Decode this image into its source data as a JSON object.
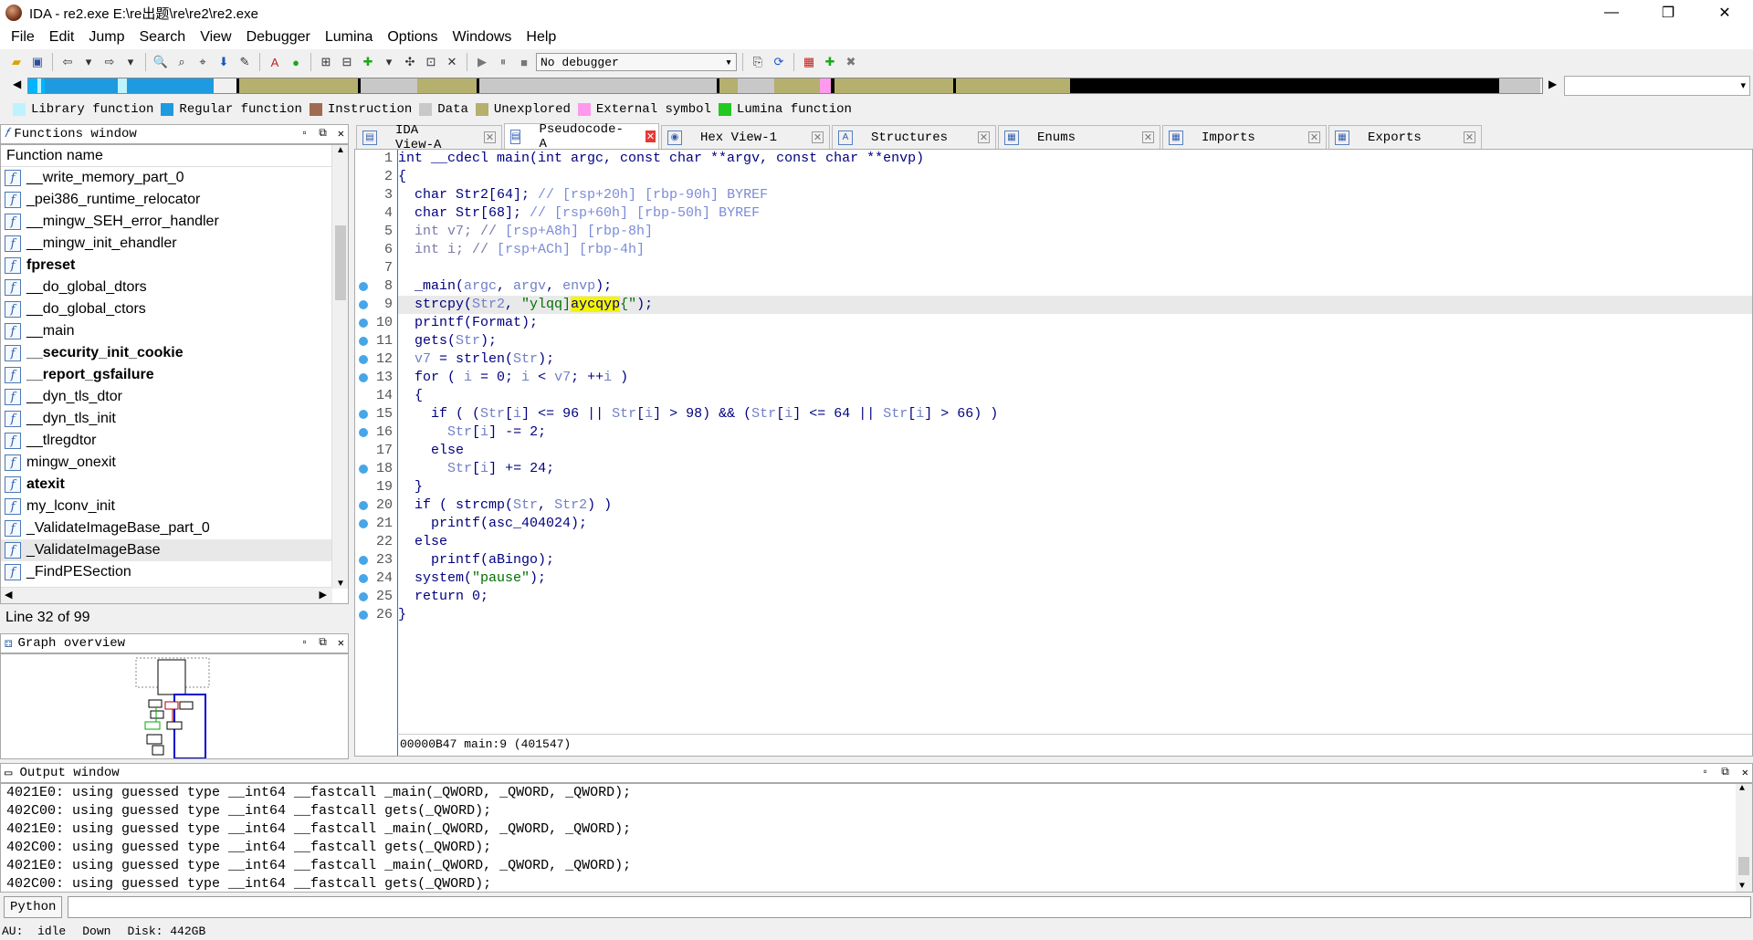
{
  "titlebar": {
    "title": "IDA - re2.exe E:\\re出题\\re\\re2\\re2.exe",
    "min": "—",
    "max": "❐",
    "close": "✕"
  },
  "menu": [
    "File",
    "Edit",
    "Jump",
    "Search",
    "View",
    "Debugger",
    "Lumina",
    "Options",
    "Windows",
    "Help"
  ],
  "toolbar": {
    "debugger_select": "No debugger"
  },
  "legend": [
    {
      "label": "Library function",
      "color": "#bdf3ff"
    },
    {
      "label": "Regular function",
      "color": "#1e9ae0"
    },
    {
      "label": "Instruction",
      "color": "#a06a50"
    },
    {
      "label": "Data",
      "color": "#c8c8c8"
    },
    {
      "label": "Unexplored",
      "color": "#b5b06d"
    },
    {
      "label": "External symbol",
      "color": "#ff99ee"
    },
    {
      "label": "Lumina function",
      "color": "#22c922"
    }
  ],
  "navstrip": [
    {
      "w": 10,
      "c": "#00b4ff"
    },
    {
      "w": 4,
      "c": "#bdf3ff"
    },
    {
      "w": 4,
      "c": "#00b4ff"
    },
    {
      "w": 80,
      "c": "#1e9ae0"
    },
    {
      "w": 10,
      "c": "#bdf3ff"
    },
    {
      "w": 95,
      "c": "#1e9ae0"
    },
    {
      "w": 25,
      "c": "#f0f0f0"
    },
    {
      "w": 3,
      "c": "#000"
    },
    {
      "w": 130,
      "c": "#b5b06d"
    },
    {
      "w": 3,
      "c": "#000"
    },
    {
      "w": 62,
      "c": "#c8c8c8"
    },
    {
      "w": 65,
      "c": "#b5b06d"
    },
    {
      "w": 3,
      "c": "#000"
    },
    {
      "w": 260,
      "c": "#c8c8c8"
    },
    {
      "w": 3,
      "c": "#000"
    },
    {
      "w": 20,
      "c": "#b5b06d"
    },
    {
      "w": 40,
      "c": "#c8c8c8"
    },
    {
      "w": 50,
      "c": "#b5b06d"
    },
    {
      "w": 12,
      "c": "#ff99ee"
    },
    {
      "w": 4,
      "c": "#000"
    },
    {
      "w": 130,
      "c": "#b5b06d"
    },
    {
      "w": 3,
      "c": "#000"
    },
    {
      "w": 125,
      "c": "#b5b06d"
    },
    {
      "w": 470,
      "c": "#000"
    },
    {
      "w": 45,
      "c": "#c8c8c8"
    }
  ],
  "functions": {
    "title": "Functions window",
    "column": "Function name",
    "items": [
      {
        "name": "__write_memory_part_0",
        "bold": false
      },
      {
        "name": "_pei386_runtime_relocator",
        "bold": false
      },
      {
        "name": "__mingw_SEH_error_handler",
        "bold": false
      },
      {
        "name": "__mingw_init_ehandler",
        "bold": false
      },
      {
        "name": "fpreset",
        "bold": true
      },
      {
        "name": "__do_global_dtors",
        "bold": false
      },
      {
        "name": "__do_global_ctors",
        "bold": false
      },
      {
        "name": "__main",
        "bold": false
      },
      {
        "name": "__security_init_cookie",
        "bold": true
      },
      {
        "name": "__report_gsfailure",
        "bold": true
      },
      {
        "name": "__dyn_tls_dtor",
        "bold": false
      },
      {
        "name": "__dyn_tls_init",
        "bold": false
      },
      {
        "name": "__tlregdtor",
        "bold": false
      },
      {
        "name": "mingw_onexit",
        "bold": false
      },
      {
        "name": "atexit",
        "bold": true
      },
      {
        "name": "my_lconv_init",
        "bold": false
      },
      {
        "name": "_ValidateImageBase_part_0",
        "bold": false
      },
      {
        "name": "_ValidateImageBase",
        "bold": false,
        "selected": true
      },
      {
        "name": "_FindPESection",
        "bold": false
      }
    ],
    "status": "Line 32 of 99"
  },
  "graph": {
    "title": "Graph overview"
  },
  "tabs": [
    {
      "label": "IDA View-A",
      "icon": "▤",
      "active": false
    },
    {
      "label": "Pseudocode-A",
      "icon": "▤",
      "active": true
    },
    {
      "label": "Hex View-1",
      "icon": "◉",
      "active": false
    },
    {
      "label": "Structures",
      "icon": "A",
      "active": false
    },
    {
      "label": "Enums",
      "icon": "▦",
      "active": false
    },
    {
      "label": "Imports",
      "icon": "▦",
      "active": false
    },
    {
      "label": "Exports",
      "icon": "▦",
      "active": false
    }
  ],
  "code": {
    "lines": [
      [
        {
          "t": "int __cdecl main(int argc, const char **argv, const char **envp)"
        }
      ],
      [
        {
          "t": "{"
        }
      ],
      [
        {
          "t": "  char Str2[64]; "
        },
        {
          "t": "// [rsp+20h] [rbp-90h] BYREF",
          "c": "cmv"
        }
      ],
      [
        {
          "t": "  char Str[68]; "
        },
        {
          "t": "// [rsp+60h] [rbp-50h] BYREF",
          "c": "cmv"
        }
      ],
      [
        {
          "t": "  int v7; // ",
          "c": "cm"
        },
        {
          "t": "[rsp+A8h] [rbp-8h]",
          "c": "cmv"
        }
      ],
      [
        {
          "t": "  int i; // ",
          "c": "cm"
        },
        {
          "t": "[rsp+ACh] [rbp-4h]",
          "c": "cmv"
        }
      ],
      [
        {
          "t": ""
        }
      ],
      [
        {
          "t": "  _main("
        },
        {
          "t": "argc",
          "c": "v"
        },
        {
          "t": ", "
        },
        {
          "t": "argv",
          "c": "v"
        },
        {
          "t": ", "
        },
        {
          "t": "envp",
          "c": "v"
        },
        {
          "t": ");"
        }
      ],
      [
        {
          "t": "  strcpy("
        },
        {
          "t": "Str2",
          "c": "v"
        },
        {
          "t": ", "
        },
        {
          "t": "\"ylqq]",
          "c": "str"
        },
        {
          "t": "aycqyp",
          "c": "yhl"
        },
        {
          "t": "{\"",
          "c": "str"
        },
        {
          "t": ");"
        }
      ],
      [
        {
          "t": "  printf(Format);"
        }
      ],
      [
        {
          "t": "  gets("
        },
        {
          "t": "Str",
          "c": "v"
        },
        {
          "t": ");"
        }
      ],
      [
        {
          "t": "  "
        },
        {
          "t": "v7",
          "c": "v"
        },
        {
          "t": " = strlen("
        },
        {
          "t": "Str",
          "c": "v"
        },
        {
          "t": ");"
        }
      ],
      [
        {
          "t": "  for ( "
        },
        {
          "t": "i",
          "c": "v"
        },
        {
          "t": " = 0; "
        },
        {
          "t": "i",
          "c": "v"
        },
        {
          "t": " < "
        },
        {
          "t": "v7",
          "c": "v"
        },
        {
          "t": "; ++"
        },
        {
          "t": "i",
          "c": "v"
        },
        {
          "t": " )"
        }
      ],
      [
        {
          "t": "  {"
        }
      ],
      [
        {
          "t": "    if ( ("
        },
        {
          "t": "Str",
          "c": "v"
        },
        {
          "t": "["
        },
        {
          "t": "i",
          "c": "v"
        },
        {
          "t": "] <= 96 || "
        },
        {
          "t": "Str",
          "c": "v"
        },
        {
          "t": "["
        },
        {
          "t": "i",
          "c": "v"
        },
        {
          "t": "] > 98) && ("
        },
        {
          "t": "Str",
          "c": "v"
        },
        {
          "t": "["
        },
        {
          "t": "i",
          "c": "v"
        },
        {
          "t": "] <= 64 || "
        },
        {
          "t": "Str",
          "c": "v"
        },
        {
          "t": "["
        },
        {
          "t": "i",
          "c": "v"
        },
        {
          "t": "] > 66) )"
        }
      ],
      [
        {
          "t": "      "
        },
        {
          "t": "Str",
          "c": "v"
        },
        {
          "t": "["
        },
        {
          "t": "i",
          "c": "v"
        },
        {
          "t": "] -= 2;"
        }
      ],
      [
        {
          "t": "    else"
        }
      ],
      [
        {
          "t": "      "
        },
        {
          "t": "Str",
          "c": "v"
        },
        {
          "t": "["
        },
        {
          "t": "i",
          "c": "v"
        },
        {
          "t": "] += 24;"
        }
      ],
      [
        {
          "t": "  }"
        }
      ],
      [
        {
          "t": "  if ( strcmp("
        },
        {
          "t": "Str",
          "c": "v"
        },
        {
          "t": ", "
        },
        {
          "t": "Str2",
          "c": "v"
        },
        {
          "t": ") )"
        }
      ],
      [
        {
          "t": "    printf(asc_404024);"
        }
      ],
      [
        {
          "t": "  else"
        }
      ],
      [
        {
          "t": "    printf(aBingo);"
        }
      ],
      [
        {
          "t": "  system("
        },
        {
          "t": "\"pause\"",
          "c": "str"
        },
        {
          "t": ");"
        }
      ],
      [
        {
          "t": "  return 0;"
        }
      ],
      [
        {
          "t": "}"
        }
      ]
    ],
    "breakpoints": [
      8,
      9,
      10,
      11,
      12,
      13,
      15,
      16,
      18,
      20,
      21,
      23,
      24,
      25,
      26
    ],
    "highlighted_line": 9,
    "status": "00000B47 main:9 (401547)"
  },
  "output": {
    "title": "Output window",
    "lines": [
      "4021E0: using guessed type __int64 __fastcall _main(_QWORD, _QWORD, _QWORD);",
      "402C00: using guessed type __int64 __fastcall gets(_QWORD);",
      "4021E0: using guessed type __int64 __fastcall _main(_QWORD, _QWORD, _QWORD);",
      "402C00: using guessed type __int64 __fastcall gets(_QWORD);",
      "4021E0: using guessed type __int64 __fastcall _main(_QWORD, _QWORD, _QWORD);",
      "402C00: using guessed type __int64 __fastcall gets(_QWORD);"
    ]
  },
  "python": {
    "button": "Python"
  },
  "status": {
    "au": "AU:",
    "state": "idle",
    "dir": "Down",
    "disk": "Disk: 442GB"
  }
}
